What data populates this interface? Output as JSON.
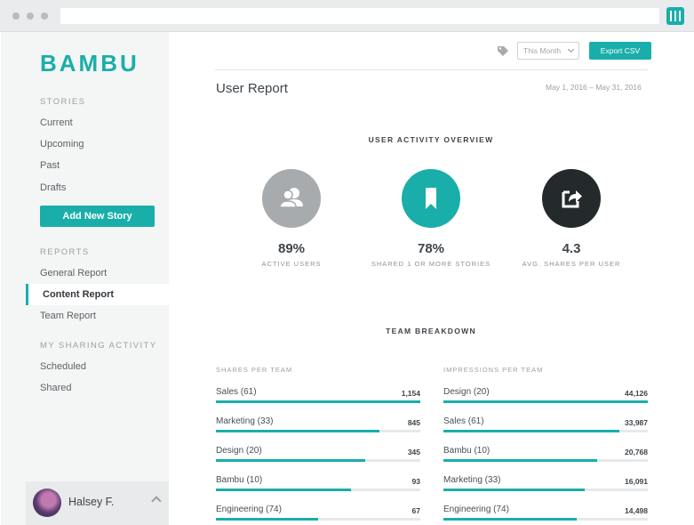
{
  "colors": {
    "accent": "#1aaeaa",
    "dark": "#24292b",
    "gray": "#a7abae"
  },
  "sidebar": {
    "logo": "BAMBU",
    "stories_heading": "STORIES",
    "stories": [
      "Current",
      "Upcoming",
      "Past",
      "Drafts"
    ],
    "add_button": "Add New Story",
    "reports_heading": "REPORTS",
    "reports": [
      "General Report",
      "Content Report",
      "Team Report"
    ],
    "active_item": "Content Report",
    "sharing_heading": "MY SHARING ACTIVITY",
    "sharing": [
      "Scheduled",
      "Shared"
    ],
    "user": {
      "name": "Halsey F."
    }
  },
  "toolbar": {
    "filter": "This Month",
    "export": "Export CSV",
    "tag_icon": "tag-icon"
  },
  "report": {
    "title": "User Report",
    "date_range": "May 1, 2016 – May 31, 2016"
  },
  "overview": {
    "heading": "USER ACTIVITY OVERVIEW",
    "stats": [
      {
        "value": "89%",
        "label": "ACTIVE USERS",
        "icon": "users-icon",
        "color": "#a7abae"
      },
      {
        "value": "78%",
        "label": "SHARED 1 OR MORE STORIES",
        "icon": "bookmark-icon",
        "color": "#1aaeaa"
      },
      {
        "value": "4.3",
        "label": "AVG. SHARES PER USER",
        "icon": "share-icon",
        "color": "#24292b"
      }
    ]
  },
  "breakdown": {
    "heading": "TEAM BREAKDOWN",
    "shares": {
      "heading": "SHARES PER TEAM",
      "rows": [
        {
          "name": "Sales (61)",
          "value": "1,154",
          "fraction": 1.0
        },
        {
          "name": "Marketing (33)",
          "value": "845",
          "fraction": 0.8
        },
        {
          "name": "Design (20)",
          "value": "345",
          "fraction": 0.73
        },
        {
          "name": "Bambu (10)",
          "value": "93",
          "fraction": 0.66
        },
        {
          "name": "Engineering (74)",
          "value": "67",
          "fraction": 0.5
        }
      ]
    },
    "impressions": {
      "heading": "IMPRESSIONS PER TEAM",
      "rows": [
        {
          "name": "Design (20)",
          "value": "44,126",
          "fraction": 1.0
        },
        {
          "name": "Sales (61)",
          "value": "33,987",
          "fraction": 0.86
        },
        {
          "name": "Bambu (10)",
          "value": "20,768",
          "fraction": 0.75
        },
        {
          "name": "Marketing (33)",
          "value": "16,091",
          "fraction": 0.69
        },
        {
          "name": "Engineering (74)",
          "value": "14,498",
          "fraction": 0.65
        }
      ]
    }
  }
}
